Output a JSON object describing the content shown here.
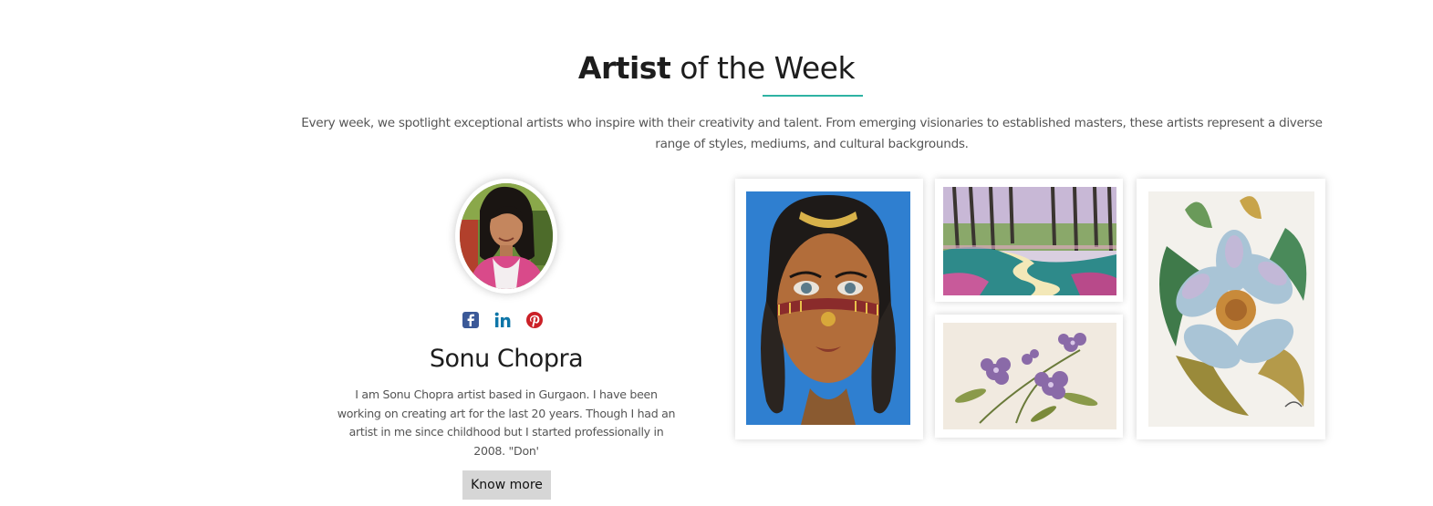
{
  "section": {
    "title_strong": "Artist",
    "title_rest": "of the Week",
    "intro": "Every week, we spotlight exceptional artists who inspire with their creativity and talent. From emerging visionaries to established masters, these artists represent a diverse range of styles, mediums, and cultural backgrounds."
  },
  "artist": {
    "name": "Sonu Chopra",
    "bio": "I am Sonu Chopra artist based in Gurgaon. I have been working on creating art for the last 20 years. Though I had an artist in me since childhood but I started professionally in 2008. \"Don'",
    "know_more_label": "Know more",
    "socials": [
      {
        "icon": "facebook-icon",
        "color": "#3b5998"
      },
      {
        "icon": "linkedin-icon",
        "color": "#0e76a8"
      },
      {
        "icon": "pinterest-icon",
        "color": "#cb2027"
      }
    ]
  },
  "colors": {
    "accent": "#2fb3a3",
    "button_bg": "#d6d6d6"
  }
}
